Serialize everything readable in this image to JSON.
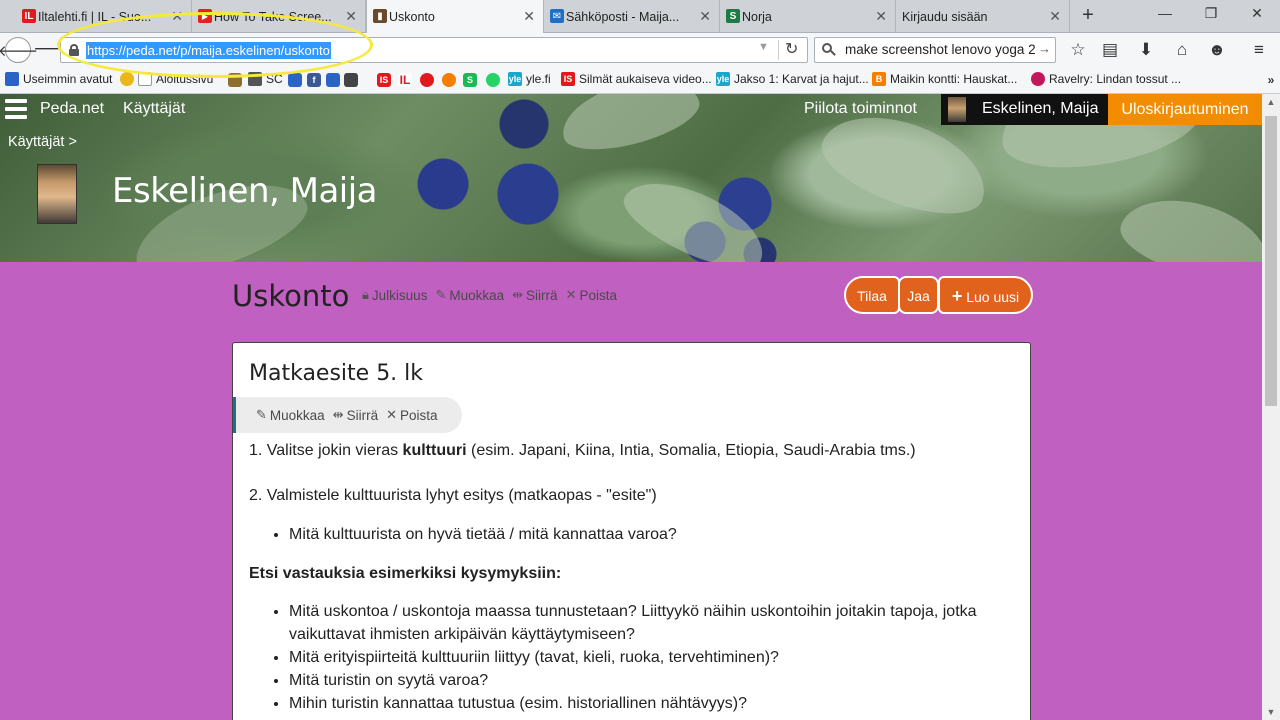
{
  "browser": {
    "tabs": [
      {
        "label": "Iltalehti.fi | IL - Suo...",
        "favicon": "iltalehti-icon",
        "color": "#e0191e",
        "glyph": "IL"
      },
      {
        "label": "How To Take Scree...",
        "favicon": "youtube-icon",
        "color": "#e62117",
        "glyph": "▶"
      },
      {
        "label": "Uskonto",
        "favicon": "peda-icon",
        "color": "#6b4a2a",
        "glyph": "▮"
      },
      {
        "label": "Sähköposti - Maija...",
        "favicon": "mail-icon",
        "color": "#1f6fc4",
        "glyph": "✉"
      },
      {
        "label": "Norja",
        "favicon": "sway-icon",
        "color": "#1e7b45",
        "glyph": "S"
      },
      {
        "label": "Kirjaudu sisään",
        "favicon": "blank-icon",
        "color": "#cfd3d8",
        "glyph": ""
      }
    ],
    "url": "https://peda.net/p/maija.eskelinen/uskonto",
    "search_text": "make screenshot lenovo yoga 2",
    "bookmarks": [
      {
        "label": "Useimmin avatut",
        "color": "#2a64c5"
      },
      {
        "label": "Aloitussivu",
        "color": "#eab61a"
      },
      {
        "label": "SC",
        "color": "#8c6f2c"
      },
      {
        "label": "yle.fi",
        "color": "#1aa7c9"
      },
      {
        "label": "Silmät aukaiseva video...",
        "color": "#e0191e"
      },
      {
        "label": "Jakso 1: Karvat ja hajut...",
        "color": "#1aa7c9"
      },
      {
        "label": "Maikin kontti: Hauskat...",
        "color": "#f57d00"
      },
      {
        "label": "Ravelry: Lindan tossut ...",
        "color": "#c2185b"
      }
    ]
  },
  "site": {
    "brand": "Peda.net",
    "nav_users": "Käyttäjät",
    "hide_actions": "Piilota toiminnot",
    "user_name": "Eskelinen, Maija",
    "logout": "Uloskirjautuminen",
    "breadcrumb": "Käyttäjät >",
    "owner_name": "Eskelinen, Maija"
  },
  "page": {
    "title": "Uskonto",
    "actions": {
      "publicity": "Julkisuus",
      "edit": "Muokkaa",
      "move": "Siirrä",
      "delete": "Poista"
    },
    "buttons": {
      "subscribe": "Tilaa",
      "share": "Jaa",
      "create": "Luo uusi"
    }
  },
  "card": {
    "title": "Matkaesite 5. lk",
    "actions": {
      "edit": "Muokkaa",
      "move": "Siirrä",
      "delete": "Poista"
    },
    "step1_pre": "1. Valitse jokin vieras ",
    "step1_bold": "kulttuuri",
    "step1_post": " (esim. Japani, Kiina, Intia, Somalia, Etiopia, Saudi-Arabia tms.)",
    "step2": "2. Valmistele kulttuurista lyhyt esitys (matkaopas - \"esite\")",
    "bullet_a": "Mitä kulttuurista on hyvä tietää / mitä kannattaa varoa?",
    "heading": "Etsi vastauksia esimerkiksi kysymyksiin:",
    "questions": [
      "Mitä uskontoa / uskontoja maassa tunnustetaan? Liittyykö näihin uskontoihin joitakin tapoja, jotka vaikuttavat ihmisten arkipäivän käyttäytymiseen?",
      "Mitä erityispiirteitä kulttuuriin liittyy (tavat, kieli, ruoka, tervehtiminen)?",
      "Mitä turistin on syytä varoa?",
      "Mihin turistin kannattaa tutustua (esim. historiallinen nähtävyys)?"
    ]
  },
  "colors": {
    "purple_bg": "#c060c0",
    "accent_orange": "#e0621d",
    "logout_orange": "#f28c00",
    "url_highlight": "#3399ff",
    "annotation_yellow": "#f5ea3c"
  }
}
